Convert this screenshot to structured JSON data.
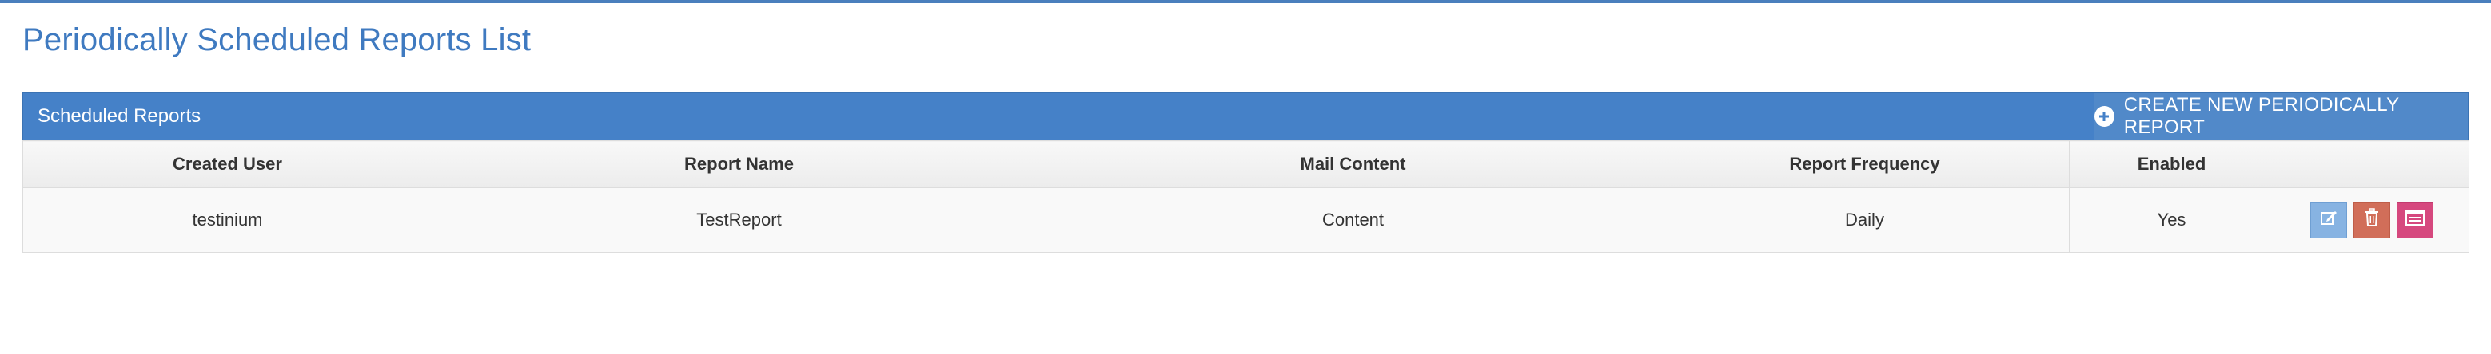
{
  "page": {
    "title": "Periodically Scheduled Reports List"
  },
  "widget": {
    "title": "Scheduled Reports",
    "create_button_label": "CREATE NEW PERIODICALLY REPORT",
    "create_button_icon": "plus-circle-icon"
  },
  "table": {
    "headers": [
      "Created User",
      "Report Name",
      "Mail Content",
      "Report Frequency",
      "Enabled",
      ""
    ],
    "rows": [
      {
        "created_user": "testinium",
        "report_name": "TestReport",
        "mail_content": "Content",
        "report_frequency": "Daily",
        "enabled": "Yes",
        "actions": [
          "edit-icon",
          "trash-icon",
          "calendar-icon"
        ]
      }
    ]
  },
  "colors": {
    "accent": "#4581c8",
    "title": "#3f7ac0",
    "edit": "#87b3e2",
    "delete": "#d16e59",
    "view": "#d6487e"
  }
}
